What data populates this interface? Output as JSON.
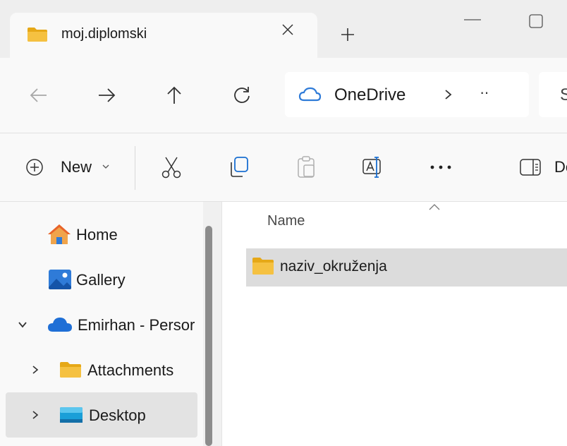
{
  "tab": {
    "title": "moj.diplomski",
    "folder_icon": "folder-icon",
    "close_icon": "close-icon",
    "new_tab_icon": "plus-icon"
  },
  "window": {
    "minimize_icon": "minimize-icon",
    "maximize_icon": "maximize-icon"
  },
  "nav": {
    "back_icon": "arrow-left-icon",
    "forward_icon": "arrow-right-icon",
    "up_icon": "arrow-up-icon",
    "refresh_icon": "refresh-icon"
  },
  "address": {
    "location": "OneDrive",
    "separator": "›",
    "overflow": "··"
  },
  "search": {
    "placeholder": "S"
  },
  "commands": {
    "new_label": "New",
    "details_label": "De"
  },
  "sidebar": {
    "items": [
      {
        "label": "Home",
        "icon": "home-icon"
      },
      {
        "label": "Gallery",
        "icon": "gallery-icon"
      },
      {
        "label": "Emirhan - Persor",
        "icon": "onedrive-cloud-icon"
      },
      {
        "label": "Attachments",
        "icon": "folder-icon"
      },
      {
        "label": "Desktop",
        "icon": "desktop-folder-icon"
      }
    ]
  },
  "main": {
    "column_header": "Name",
    "rows": [
      {
        "name": "naziv_okruženja",
        "icon": "folder-icon"
      }
    ]
  },
  "colors": {
    "folder": "#f5c141",
    "folder_dark": "#e6a817",
    "onedrive": "#2f7bd8",
    "home_roof": "#e8632a",
    "selection": "#dcdcdc",
    "sidebar_selected": "#e3e3e3"
  }
}
